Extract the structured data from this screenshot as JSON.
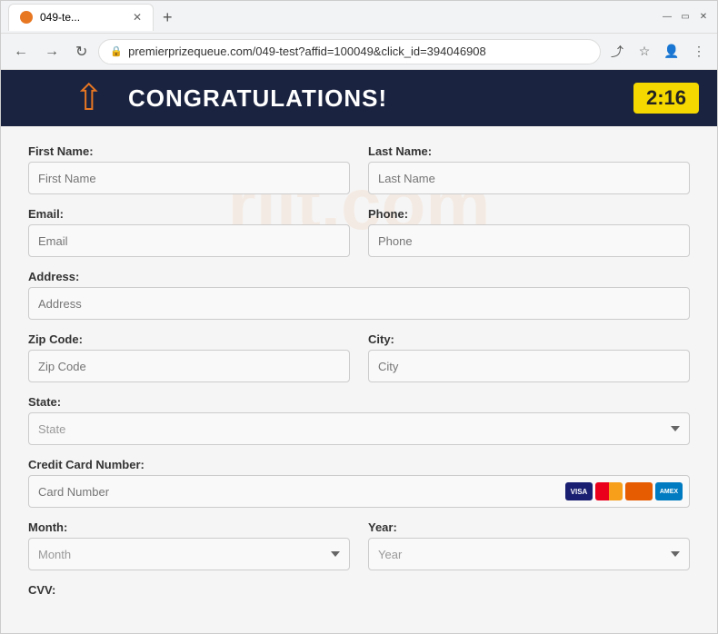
{
  "browser": {
    "tab_title": "049-te...",
    "url": "premierprizequeue.com/049-test?affid=100049&click_id=394046908",
    "new_tab_label": "+"
  },
  "header": {
    "congrats_text": "CONGRATULATIONS!",
    "timer": "2:16"
  },
  "form": {
    "first_name_label": "First Name:",
    "first_name_placeholder": "First Name",
    "last_name_label": "Last Name:",
    "last_name_placeholder": "Last Name",
    "email_label": "Email:",
    "email_placeholder": "Email",
    "phone_label": "Phone:",
    "phone_placeholder": "Phone",
    "address_label": "Address:",
    "address_placeholder": "Address",
    "zip_label": "Zip Code:",
    "zip_placeholder": "Zip Code",
    "city_label": "City:",
    "city_placeholder": "City",
    "state_label": "State:",
    "state_placeholder": "State",
    "cc_label": "Credit Card Number:",
    "cc_placeholder": "Card Number",
    "month_label": "Month:",
    "month_placeholder": "Month",
    "year_label": "Year:",
    "year_placeholder": "Year",
    "cvv_label": "CVV:"
  },
  "watermark": {
    "text": "rilt.com"
  }
}
